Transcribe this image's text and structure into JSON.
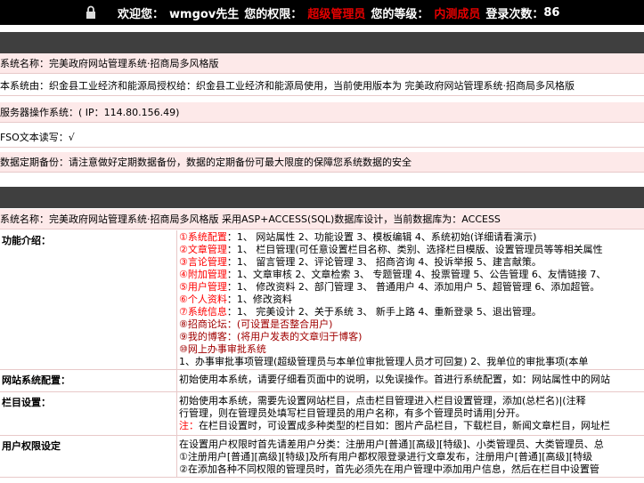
{
  "header": {
    "welcome_label": "欢迎您：",
    "username": "wmgov先生",
    "permission_label": "您的权限：",
    "permission_value": "超级管理员",
    "level_label": "您的等级：",
    "level_value": "内测成员",
    "login_count_label": "登录次数：",
    "login_count": "86"
  },
  "info_rows": [
    "系统名称：完美政府网站管理系统·招商局多风格版",
    "本系统由：织金县工业经济和能源局授权给：织金县工业经济和能源局使用，当前使用版本为 完美政府网站管理系统·招商局多风格版",
    "服务器操作系统：( IP：114.80.156.49)",
    "FSO文本读写：√",
    "数据定期备份：请注意做好定期数据备份，数据的定期备份可最大限度的保障您系统数据的安全"
  ],
  "system_row": "系统名称：完美政府网站管理系统·招商局多风格版 采用ASP+ACCESS(SQL)数据库设计，当前数据库为：ACCESS",
  "sections": {
    "intro_title": "功能介绍：",
    "intro_lines": [
      {
        "num": "①",
        "name": "系统配置",
        "rest": "：1、 网站属性 2、功能设置 3、模板编辑 4、系统初始(详细请看演示)"
      },
      {
        "num": "②",
        "name": "文章管理",
        "rest": "：1、 栏目管理(可任意设置栏目名称、类别、选择栏目模版、设置管理员等等相关属性"
      },
      {
        "num": "③",
        "name": "言论管理",
        "rest": "：1、 留言管理 2、评论管理 3、 招商咨询 4、投诉举报 5、建言献策。"
      },
      {
        "num": "④",
        "name": "附加管理",
        "rest": "：1、文章审核 2、文章检索 3、 专题管理 4、投票管理 5、公告管理 6、友情链接 7、"
      },
      {
        "num": "⑤",
        "name": "用户管理",
        "rest": "：1、 修改资料 2、部门管理 3、 普通用户 4、添加用户 5、超管管理 6、添加超管。"
      },
      {
        "num": "⑥",
        "name": "个人资料",
        "rest": "：1、修改资料"
      },
      {
        "num": "⑦",
        "name": "系统信息",
        "rest": "：1、 完美设计 2、关于系统 3、 新手上路 4、重新登录 5、退出管理。"
      }
    ],
    "intro_extra": [
      "⑧招商论坛：(可设置是否整合用户)",
      "⑨我的博客：(将用户发表的文章归于博客)",
      "⑩网上办事审批系统",
      "1、办事审批事项管理(超级管理员与本单位审批管理人员才可回复) 2、我单位的审批事项(本单"
    ],
    "config_title": "网站系统配置：",
    "config_text": "初始使用本系统，请要仔细看页面中的说明，以免误操作。首进行系统配置，如：网站属性中的网站",
    "column_title": "栏目设置：",
    "column_lines": [
      "初始使用本系统，需要先设置网站栏目，点击栏目管理进入栏目设置管理，添加(总栏名)|(注释",
      "行管理，则在管理员处填写栏目管理员的用户名称，有多个管理员时请用|分开。"
    ],
    "column_note_label": "注：",
    "column_note": "在栏目设置时，可设置成多种类型的栏目如：图片产品栏目，下载栏目，新闻文章栏目，网址栏",
    "perm_title": "用户权限设定",
    "perm_lines": [
      "在设置用户权限时首先请差用户分类：注册用户[普通][高级][特级]、小类管理员、大类管理员、总",
      "①注册用户[普通][高级][特级]及所有用户都权限登录进行文章发布，注册用户[普通][高级][特级",
      "②在添加各种不同权限的管理员时，首先必须先在用户管理中添加用户信息，然后在栏目中设置管"
    ]
  }
}
